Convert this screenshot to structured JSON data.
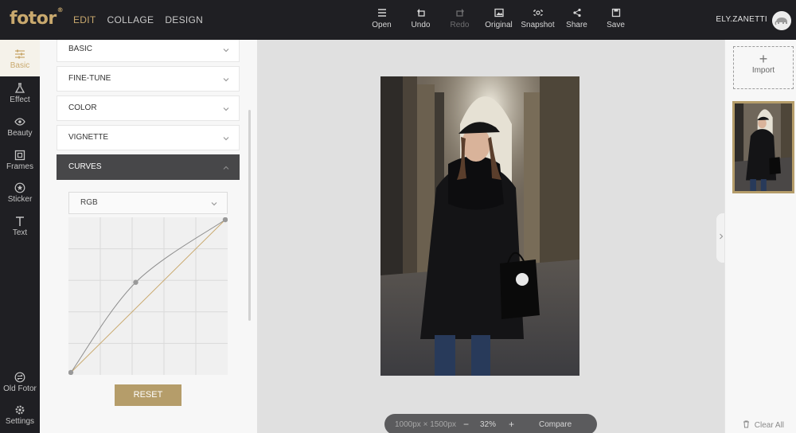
{
  "app": {
    "logo": "fotor",
    "logo_mark": "®"
  },
  "topnav": [
    {
      "label": "EDIT",
      "active": true
    },
    {
      "label": "COLLAGE",
      "active": false
    },
    {
      "label": "DESIGN",
      "active": false
    }
  ],
  "tools": [
    {
      "label": "Open",
      "icon": "menu-icon",
      "enabled": true
    },
    {
      "label": "Undo",
      "icon": "undo-icon",
      "enabled": true
    },
    {
      "label": "Redo",
      "icon": "redo-icon",
      "enabled": false
    },
    {
      "label": "Original",
      "icon": "image-icon",
      "enabled": true
    },
    {
      "label": "Snapshot",
      "icon": "camera-icon",
      "enabled": true
    },
    {
      "label": "Share",
      "icon": "share-icon",
      "enabled": true
    },
    {
      "label": "Save",
      "icon": "save-icon",
      "enabled": true
    }
  ],
  "user": {
    "name": "ELY.ZANETTI",
    "avatar": "elephant-avatar-icon"
  },
  "rail": [
    {
      "label": "Basic",
      "icon": "sliders-icon",
      "active": true
    },
    {
      "label": "Effect",
      "icon": "flask-icon",
      "active": false
    },
    {
      "label": "Beauty",
      "icon": "eye-icon",
      "active": false
    },
    {
      "label": "Frames",
      "icon": "frame-icon",
      "active": false
    },
    {
      "label": "Sticker",
      "icon": "sticker-icon",
      "active": false
    },
    {
      "label": "Text",
      "icon": "text-icon",
      "active": false
    }
  ],
  "rail_bottom": [
    {
      "label": "Old Fotor",
      "icon": "swap-icon"
    },
    {
      "label": "Settings",
      "icon": "gear-icon"
    }
  ],
  "panel": {
    "sections": [
      {
        "label": "BASIC",
        "open": false
      },
      {
        "label": "FINE-TUNE",
        "open": false
      },
      {
        "label": "COLOR",
        "open": false
      },
      {
        "label": "VIGNETTE",
        "open": false
      },
      {
        "label": "CURVES",
        "open": true
      }
    ],
    "channel": "RGB",
    "reset_label": "RESET",
    "curve_points": [
      [
        0,
        0
      ],
      [
        0.42,
        0.59
      ],
      [
        1,
        1
      ]
    ]
  },
  "canvas": {
    "dimensions": "1000px × 1500px",
    "zoom": "32%",
    "minus": "−",
    "plus": "+",
    "compare": "Compare"
  },
  "right": {
    "import_plus": "+",
    "import_label": "Import",
    "clear_label": "Clear All"
  },
  "colors": {
    "accent": "#c9a96e",
    "button": "#b59d6a",
    "dark": "#1f1f23"
  }
}
